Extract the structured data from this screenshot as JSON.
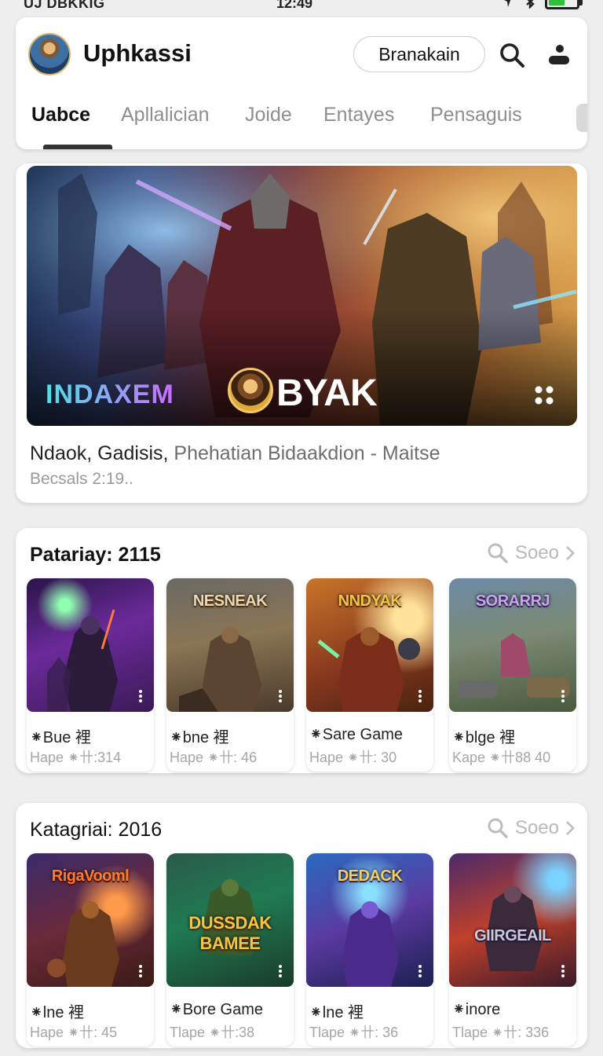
{
  "status_bar": {
    "left": "UJ DBKKIG",
    "time": "12:49"
  },
  "header": {
    "app_title": "Uphkassi",
    "action_button": "Branakain",
    "tabs": [
      {
        "label": "Uabce",
        "active": true
      },
      {
        "label": "Apllalician",
        "active": false
      },
      {
        "label": "Joide",
        "active": false
      },
      {
        "label": "Entayes",
        "active": false
      },
      {
        "label": "Pensaguis",
        "active": false
      }
    ]
  },
  "featured": {
    "logo_left": "INDAXEM",
    "logo_right": "BYAK",
    "caption_main": "Ndaok, Gadisis,",
    "caption_rest": " Phehatian Bidaakdion - Maitse",
    "subtitle": "Becsals 2:19.."
  },
  "sections": [
    {
      "title": "Patariay: 2115",
      "see_more": "Soeo",
      "games": [
        {
          "name": "⁕Bue 裡",
          "meta": "Hape ⁕卄:314",
          "banner": "",
          "theme": "purple"
        },
        {
          "name": "⁕bne 裡",
          "meta": "Hape ⁕卄: 46",
          "banner": "NESNEAK",
          "theme": "brown"
        },
        {
          "name": "⁕Sare Game",
          "meta": "Hape ⁕卄: 30",
          "banner": "NNDYAK",
          "theme": "gold"
        },
        {
          "name": "⁕blge 裡",
          "meta": "Kape ⁕卄88 40",
          "banner": "SORARRJ",
          "theme": "green"
        }
      ]
    },
    {
      "title": "Katagriai: 2016",
      "see_more": "Soeo",
      "games": [
        {
          "name": "⁕lne 裡",
          "meta": "Hape ⁕卄: 45",
          "banner": "RigaVooml",
          "theme": "orange"
        },
        {
          "name": "⁕Bore Game",
          "meta": "Tlape ⁕卄:38",
          "banner": "DUSSDAK BAMEE",
          "theme": "emerald"
        },
        {
          "name": "⁕lne 裡",
          "meta": "Tlape ⁕卄: 36",
          "banner": "DEDACK",
          "theme": "blue"
        },
        {
          "name": "⁕inore",
          "meta": "Tlape ⁕卄: 336",
          "banner": "GIIRGEAIL",
          "theme": "red"
        }
      ]
    }
  ],
  "colors": {
    "background": "#eeeeef",
    "card": "#ffffff",
    "active_tab": "#111111",
    "inactive_tab": "#8e8e8e",
    "battery": "#2fbf3b"
  },
  "icons": {
    "header_search": "search-icon",
    "header_user": "user-download-icon",
    "see_more": "search-icon",
    "featured_menu": "dots-grid-icon"
  }
}
